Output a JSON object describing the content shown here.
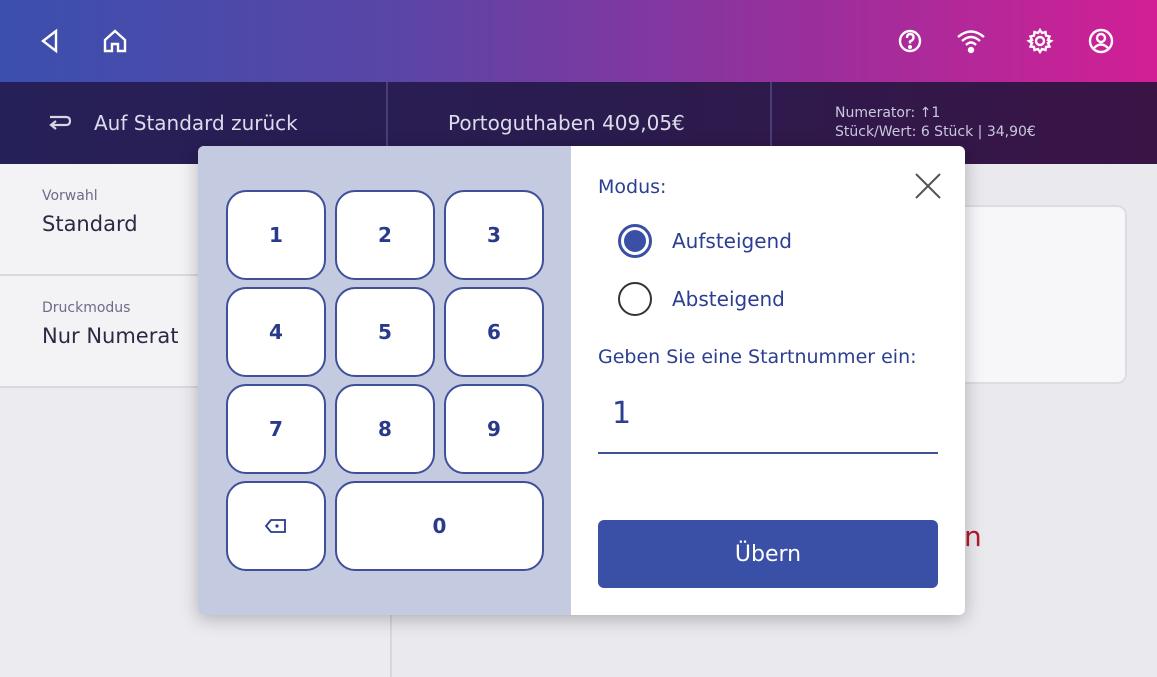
{
  "topbar": {
    "back_icon": "back-arrow-icon",
    "home_icon": "home-icon",
    "help_icon": "help-icon",
    "wifi_icon": "wifi-icon",
    "settings_icon": "gear-icon",
    "account_icon": "account-icon"
  },
  "infobar": {
    "reset_label": "Auf Standard zurück",
    "balance_label": "Portoguthaben 409,05€",
    "numerator_line1": "Numerator: ↑1",
    "numerator_line2": "Stück/Wert: 6 Stück | 34,90€"
  },
  "left_panel": {
    "items": [
      {
        "caption": "Vorwahl",
        "value": "Standard"
      },
      {
        "caption": "Druckmodus",
        "value": "Nur Numerat"
      }
    ]
  },
  "background_text": "n",
  "modal": {
    "keypad": {
      "keys": [
        "1",
        "2",
        "3",
        "4",
        "5",
        "6",
        "7",
        "8",
        "9",
        "0"
      ],
      "backspace_icon": "backspace-icon"
    },
    "mode_title": "Modus:",
    "options": [
      {
        "label": "Aufsteigend",
        "selected": true
      },
      {
        "label": "Absteigend",
        "selected": false
      }
    ],
    "start_prompt": "Geben Sie eine Startnummer ein:",
    "start_value": "1",
    "submit_label": "Übern",
    "close_icon": "close-icon"
  },
  "colors": {
    "accent": "#3a4fa6",
    "topbar_start": "#3b4fae",
    "topbar_end": "#d21f95",
    "infobar": "#262058",
    "keypad_bg": "#c4cbe1"
  }
}
